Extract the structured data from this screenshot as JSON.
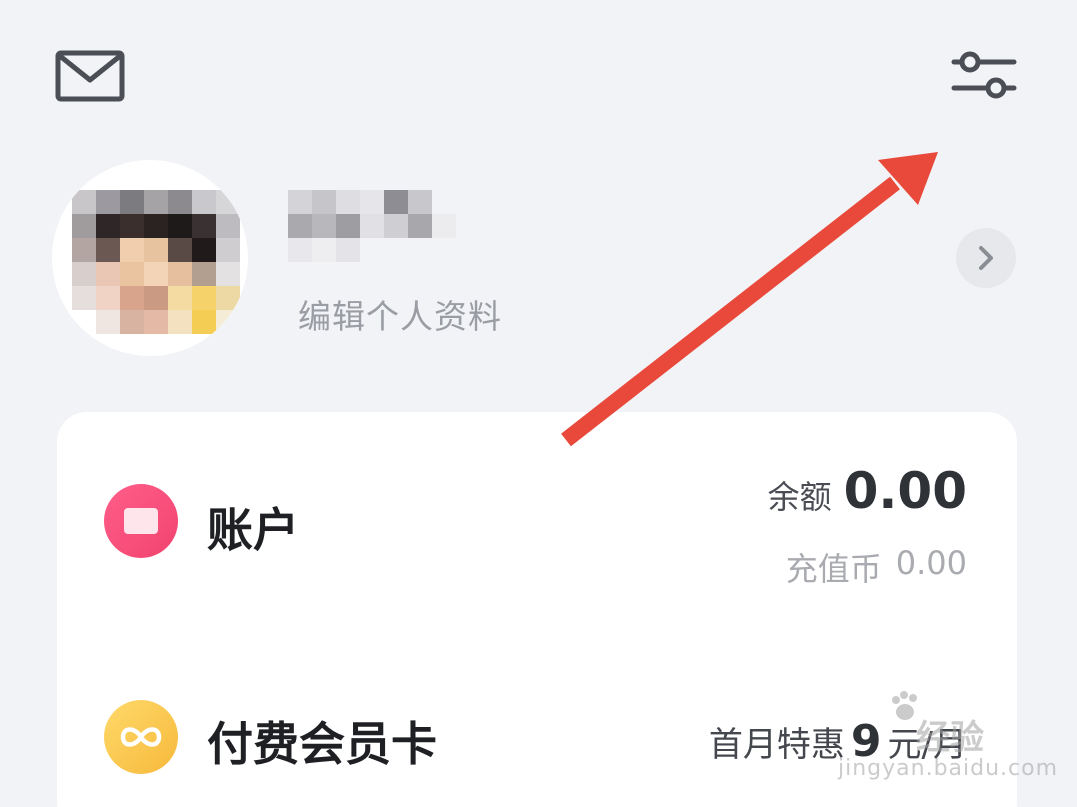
{
  "header": {
    "mail_icon": "envelope-icon",
    "settings_icon": "sliders-icon"
  },
  "profile": {
    "edit_label": "编辑个人资料",
    "chevron_icon": "chevron-right-icon"
  },
  "card": {
    "account": {
      "title": "账户",
      "icon": "wallet-icon",
      "balance_label": "余额",
      "balance_value": "0.00",
      "coins_label": "充值币",
      "coins_value": "0.00"
    },
    "membership": {
      "title": "付费会员卡",
      "icon": "infinity-icon",
      "promo_label": "首月特惠",
      "promo_price": "9",
      "promo_unit": "元/月"
    }
  },
  "colors": {
    "background": "#f2f3f6",
    "card": "#ffffff",
    "account_icon": "#f2436f",
    "member_icon": "#f6b93b",
    "annotation_arrow": "#e8493a"
  },
  "watermark": {
    "brand": "经验",
    "url": "jingyan.baidu.com"
  }
}
